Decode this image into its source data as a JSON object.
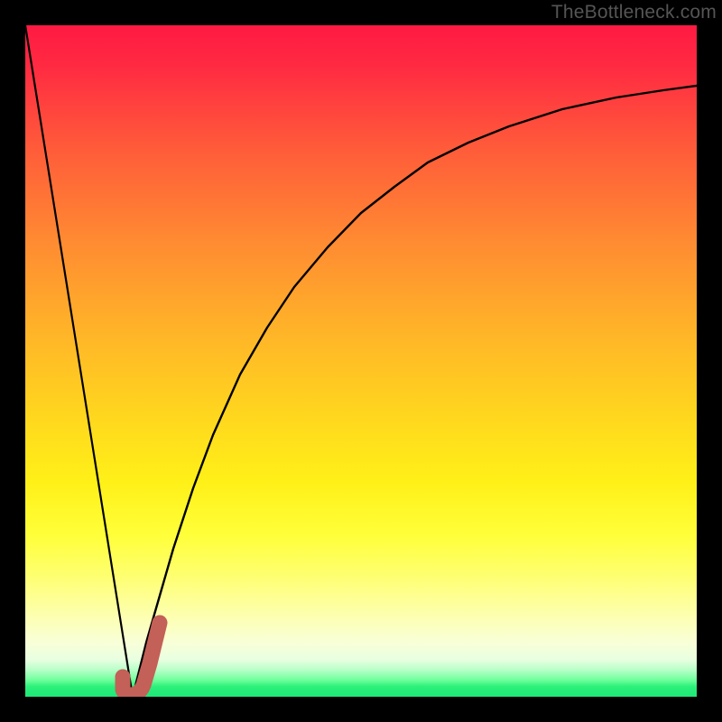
{
  "watermark": "TheBottleneck.com",
  "colors": {
    "frame": "#000000",
    "curve": "#000000",
    "marker": "#c36058"
  },
  "chart_data": {
    "type": "line",
    "title": "",
    "xlabel": "",
    "ylabel": "",
    "xlim": [
      0,
      100
    ],
    "ylim": [
      0,
      100
    ],
    "grid": false,
    "legend": false,
    "series": [
      {
        "name": "left-branch",
        "x": [
          0,
          16.0
        ],
        "y": [
          100,
          0
        ],
        "note": "straight descending segment from top-left to valley"
      },
      {
        "name": "right-branch",
        "x": [
          16.0,
          18,
          20,
          22,
          25,
          28,
          32,
          36,
          40,
          45,
          50,
          55,
          60,
          66,
          72,
          80,
          88,
          95,
          100
        ],
        "y": [
          0,
          8,
          15,
          22,
          31,
          39,
          48,
          55,
          61,
          67,
          72,
          76,
          79.5,
          82.5,
          85,
          87.5,
          89.3,
          90.3,
          91
        ],
        "note": "rising saturating curve from valley toward upper right"
      }
    ],
    "marker": {
      "name": "J-shaped-highlight",
      "points_xy": [
        [
          14.6,
          3.0
        ],
        [
          14.6,
          1.0
        ],
        [
          15.2,
          0.4
        ],
        [
          16.5,
          0.3
        ],
        [
          17.5,
          1.5
        ],
        [
          18.5,
          5.0
        ],
        [
          20.0,
          11.0
        ]
      ],
      "stroke_width_pct": 2.3
    },
    "background_gradient": {
      "direction": "top-to-bottom",
      "stops": [
        {
          "pos": 0.0,
          "color": "#ff1a42"
        },
        {
          "pos": 0.45,
          "color": "#ffb528"
        },
        {
          "pos": 0.75,
          "color": "#ffff3a"
        },
        {
          "pos": 0.96,
          "color": "#70ff9c"
        },
        {
          "pos": 1.0,
          "color": "#1de977"
        }
      ]
    }
  }
}
